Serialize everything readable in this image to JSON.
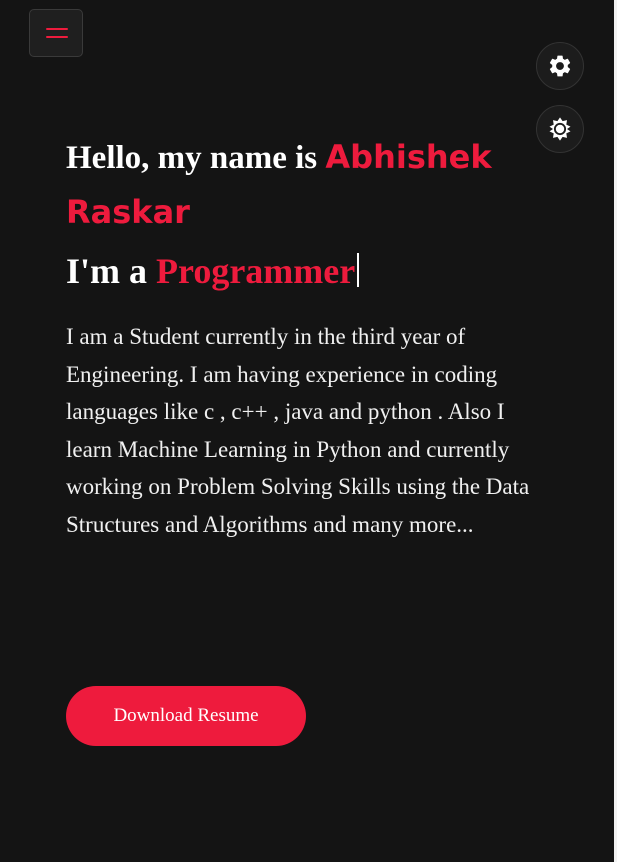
{
  "header": {
    "menu_icon": "hamburger-menu-icon",
    "settings_icon": "gear-icon",
    "theme_icon": "sun-icon"
  },
  "hero": {
    "greeting_prefix": "Hello, my name is",
    "name": "Abhishek Raskar",
    "role_prefix": "I'm a",
    "role": "Programmer",
    "about": "I am a Student currently in the third year of Engineering. I am having experience in coding languages like c , c++ , java and python . Also I learn Machine Learning in Python and currently working on Problem Solving Skills using the Data Structures and Algorithms and many more...",
    "download_label": "Download Resume"
  },
  "colors": {
    "accent": "#ee1b3d",
    "background": "#141414",
    "text": "#ffffff"
  }
}
